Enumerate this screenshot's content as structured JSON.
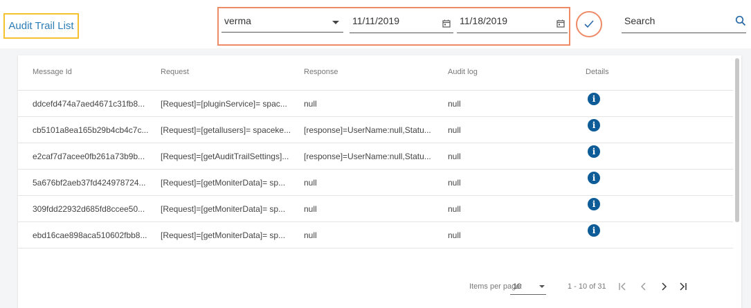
{
  "header": {
    "title": "Audit Trail List",
    "user_select": {
      "selected": "verma"
    },
    "start_date": "11/11/2019",
    "end_date": "11/18/2019",
    "search": {
      "placeholder": "Search"
    }
  },
  "table": {
    "columns": [
      "Message Id",
      "Request",
      "Response",
      "Audit log",
      "Details"
    ],
    "rows": [
      {
        "message_id": "ddcefd474a7aed4671c31fb8...",
        "request": "[Request]=[pluginService]= spac...",
        "response": "null",
        "audit_log": "null"
      },
      {
        "message_id": "cb5101a8ea165b29b4cb4c7c...",
        "request": "[Request]=[getallusers]= spaceke...",
        "response": "[response]=UserName:null,Statu...",
        "audit_log": "null"
      },
      {
        "message_id": "e2caf7d7acee0fb261a73b9b...",
        "request": "[Request]=[getAuditTrailSettings]...",
        "response": "[response]=UserName:null,Statu...",
        "audit_log": "null"
      },
      {
        "message_id": "5a676bf2aeb37fd424978724...",
        "request": "[Request]=[getMoniterData]= sp...",
        "response": "null",
        "audit_log": "null"
      },
      {
        "message_id": "309fdd22932d685fd8ccee50...",
        "request": "[Request]=[getMoniterData]= sp...",
        "response": "null",
        "audit_log": "null"
      },
      {
        "message_id": "ebd16cae898aca510602fbb8...",
        "request": "[Request]=[getMoniterData]= sp...",
        "response": "null",
        "audit_log": "null"
      }
    ]
  },
  "pagination": {
    "items_per_page_label": "Items per page:",
    "items_per_page": "10",
    "range": "1 - 10 of 31"
  },
  "colors": {
    "accent_orange": "#ee8a66",
    "title_border": "#f5c12e",
    "title_text": "#2b7db8",
    "info_icon": "#0d5b97"
  }
}
